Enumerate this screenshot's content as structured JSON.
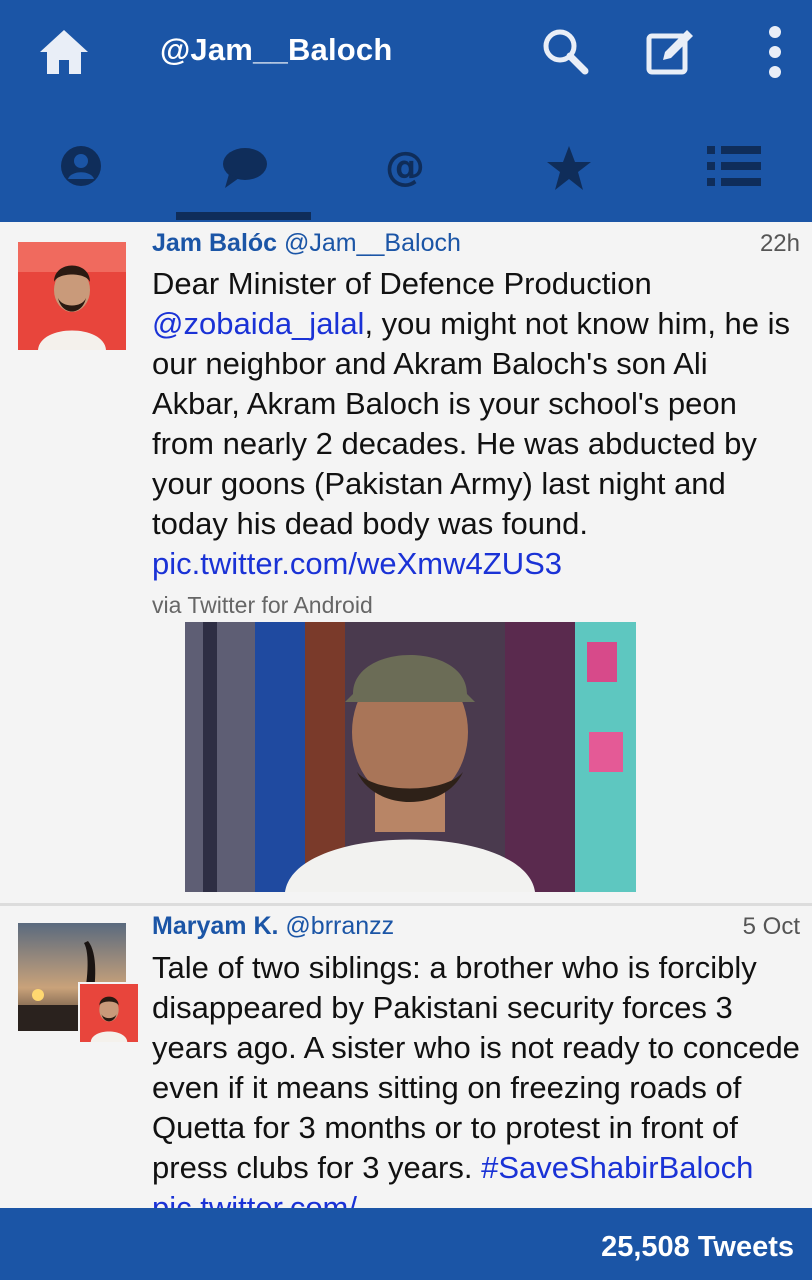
{
  "header": {
    "account_title": "@Jam__Baloch",
    "icons": [
      "home-icon",
      "search-icon",
      "compose-icon",
      "more-vertical-icon"
    ]
  },
  "tabs": [
    {
      "name": "profile",
      "icon": "person-icon"
    },
    {
      "name": "messages",
      "icon": "speech-bubble-icon",
      "selected": true
    },
    {
      "name": "mentions",
      "icon": "at-sign-icon"
    },
    {
      "name": "favorites",
      "icon": "star-icon"
    },
    {
      "name": "lists",
      "icon": "list-icon"
    }
  ],
  "tweets": [
    {
      "name": "Jam Balóc",
      "handle": "@Jam__Baloch",
      "time": "22h",
      "body_intro": "Dear Minister of Defence Production",
      "mention": "@zobaida_jalal",
      "body_main": ", you might not know him, he is our neighbor and Akram Baloch's son Ali Akbar, Akram Baloch is your school's peon from nearly 2 decades. He was abducted by your goons (Pakistan Army) last night and today his dead body was found.",
      "link": "pic.twitter.com/weXmw4ZUS3",
      "via": "via Twitter for Android"
    },
    {
      "name": "Maryam K.",
      "handle": "@brranzz",
      "time": "5 Oct",
      "body_main": "Tale of two siblings: a brother who is forcibly disappeared by Pakistani security forces 3 years ago. A sister who is not ready to concede even if it means sitting on freezing roads of Quetta for 3 months or to protest in front of press clubs for 3 years.",
      "hashtag": "#SaveShabirBaloch",
      "link": "pic.twitter.com/"
    }
  ],
  "footer": {
    "tweet_count": "25,508 Tweets"
  },
  "colors": {
    "bar": "#1b55a6",
    "tab_underline": "#0f2d5a",
    "link": "#1a32d6",
    "name": "#1b55a6"
  }
}
